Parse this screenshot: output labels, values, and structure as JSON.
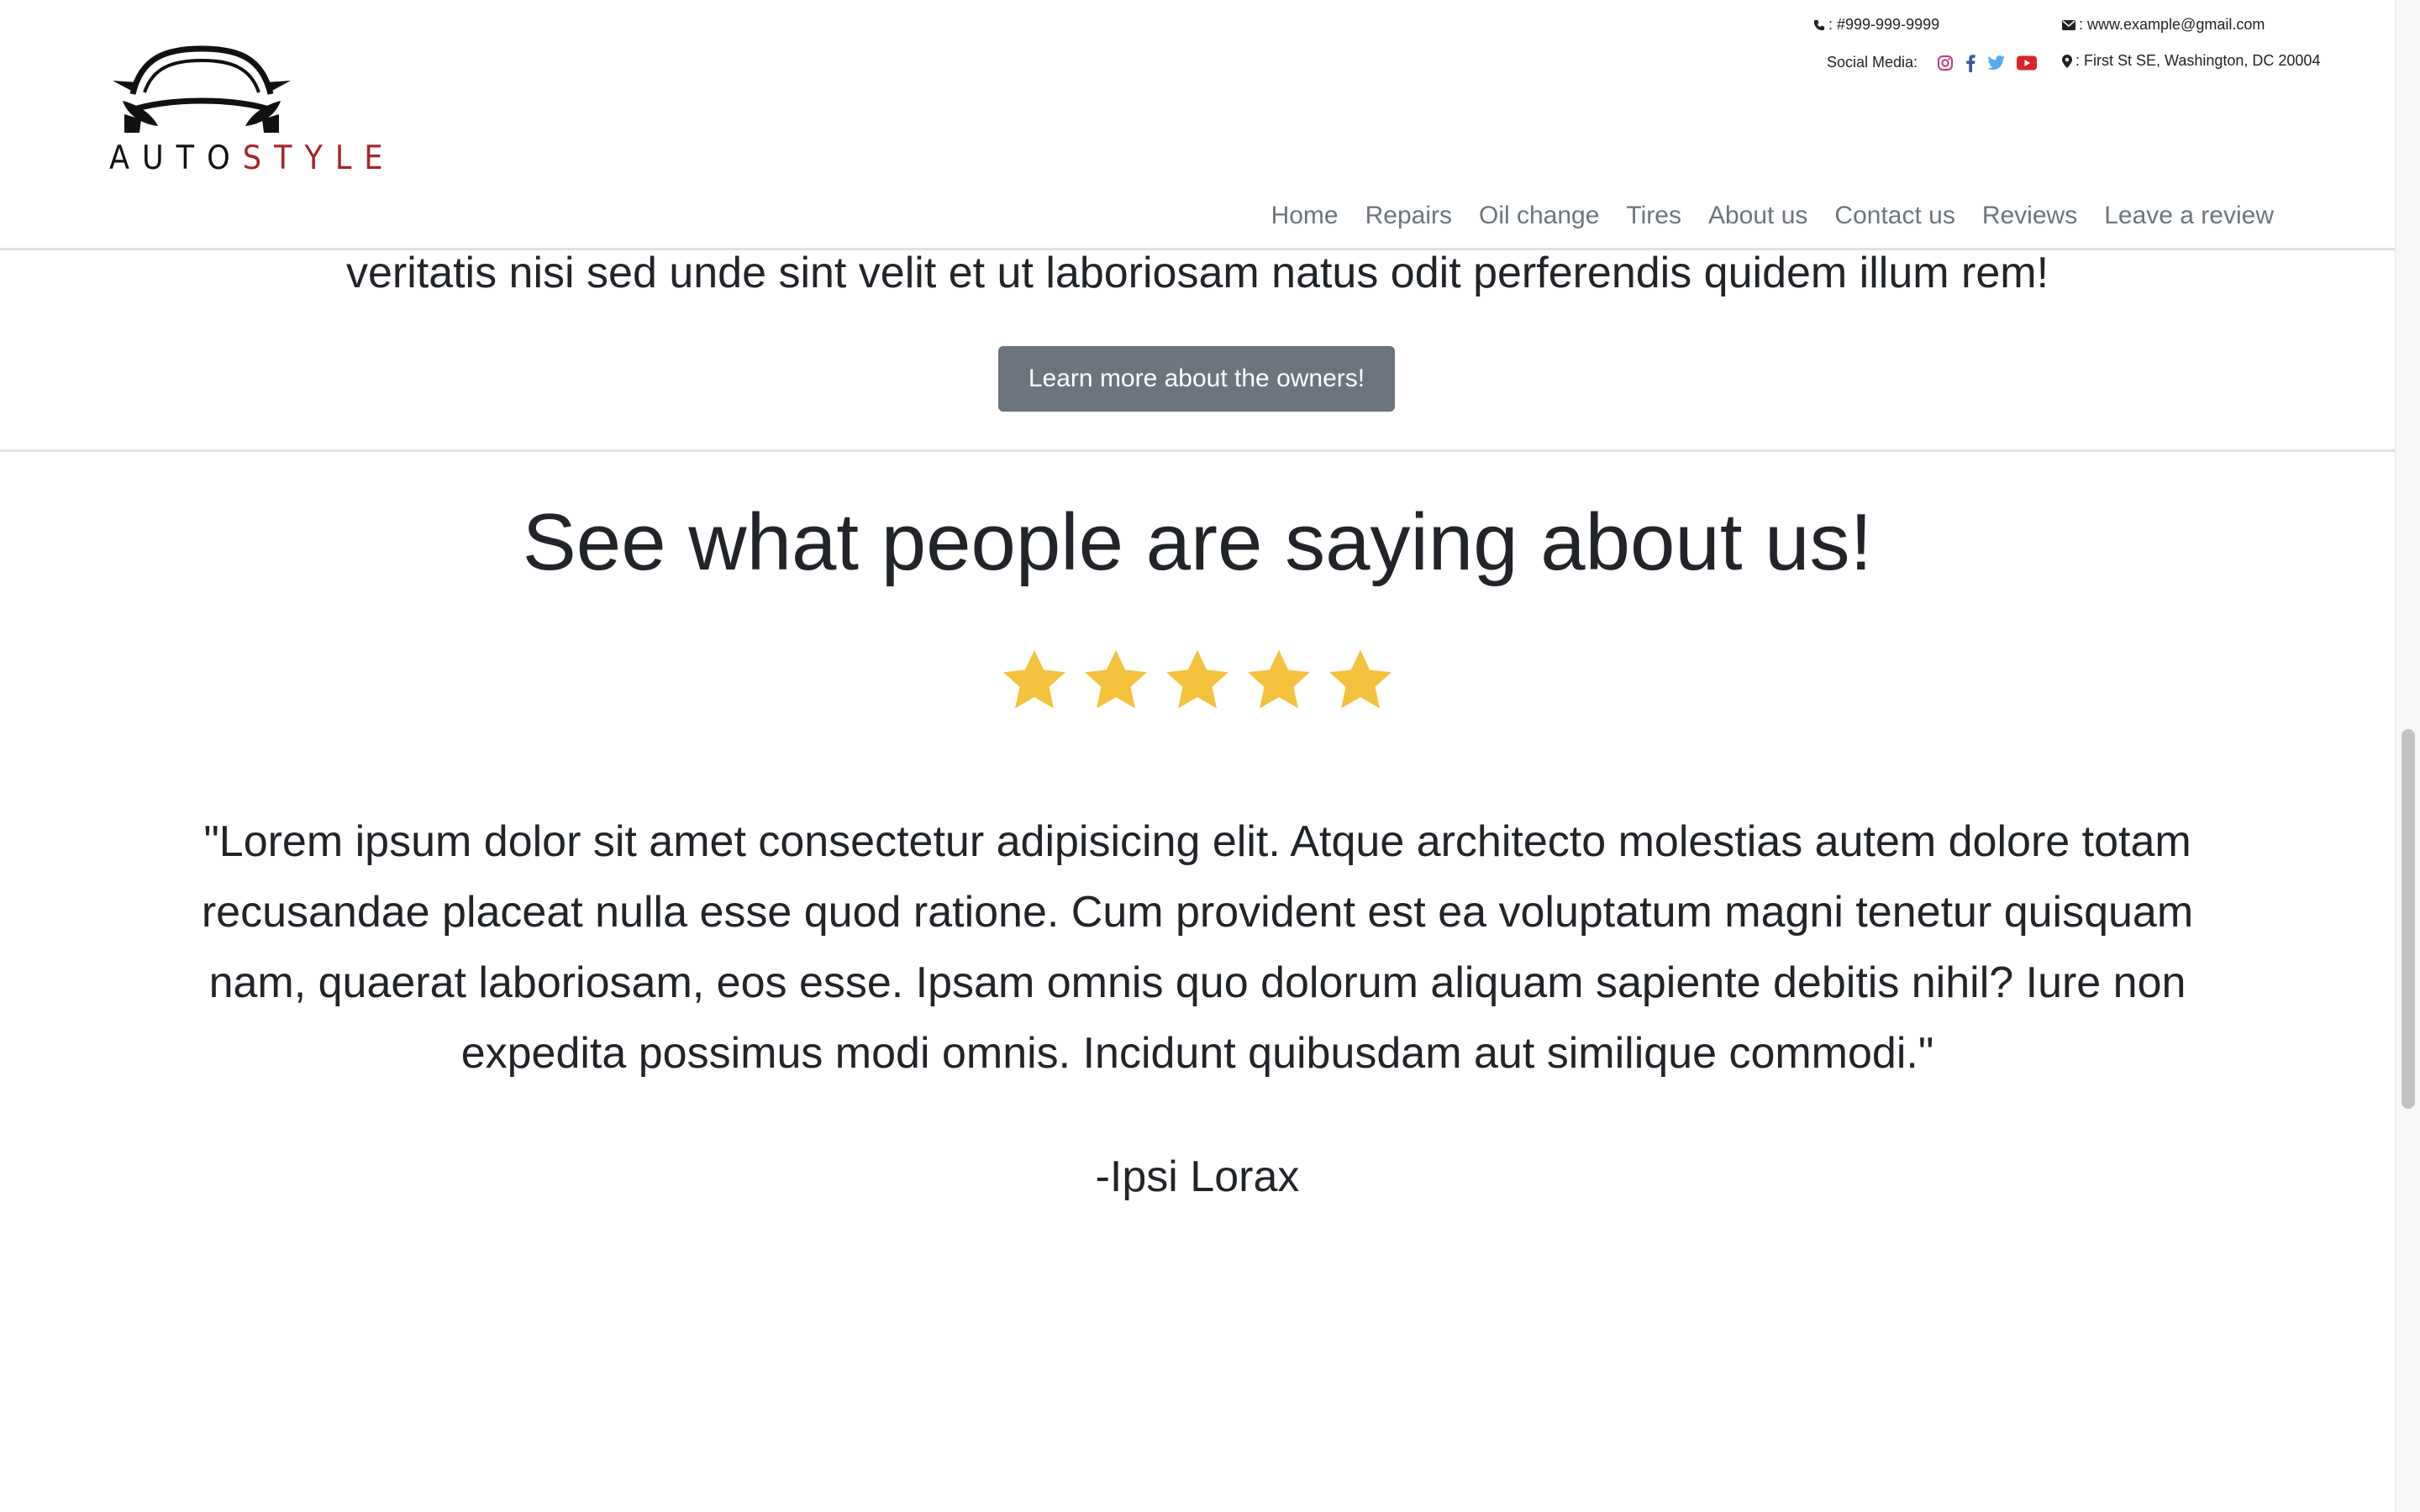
{
  "brand": {
    "logo_word_dark": "AUTO",
    "logo_word_accent": "STYLE",
    "accent_color": "#a3272b"
  },
  "contact": {
    "phone": ": #999-999-9999",
    "email": ": www.example@gmail.com",
    "address": ": First St SE, Washington, DC 20004",
    "social_label": "Social Media:",
    "social_icons": [
      "instagram-icon",
      "facebook-icon",
      "twitter-icon",
      "youtube-icon"
    ]
  },
  "nav": {
    "items": [
      {
        "label": "Home"
      },
      {
        "label": "Repairs"
      },
      {
        "label": "Oil change"
      },
      {
        "label": "Tires"
      },
      {
        "label": "About us"
      },
      {
        "label": "Contact us"
      },
      {
        "label": "Reviews"
      },
      {
        "label": "Leave a review"
      }
    ]
  },
  "about": {
    "text_tail": "veritatis nisi sed unde sint velit et ut laboriosam natus odit perferendis quidem illum rem!",
    "button_label": "Learn more about the owners!",
    "button_color": "#6c757d"
  },
  "reviews": {
    "title": "See what people are saying about us!",
    "rating": 5,
    "rating_max": 5,
    "star_color": "#f4c23d",
    "quote": "\"Lorem ipsum dolor sit amet consectetur adipisicing elit. Atque architecto molestias autem dolore totam recusandae placeat nulla esse quod ratione. Cum provident est ea voluptatum magni tenetur quisquam nam, quaerat laboriosam, eos esse. Ipsam omnis quo dolorum aliquam sapiente debitis nihil? Iure non expedita possimus modi omnis. Incidunt quibusdam aut similique commodi.\"",
    "author": "-Ipsi Lorax"
  }
}
